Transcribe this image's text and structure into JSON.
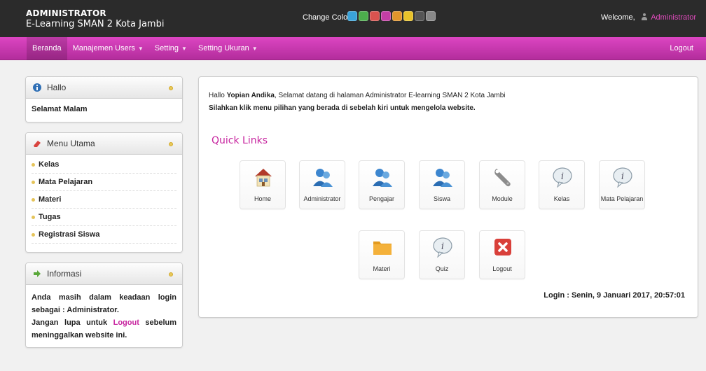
{
  "header": {
    "line1": "ADMINISTRATOR",
    "line2": "E-Learning SMAN 2 Kota Jambi",
    "change_color_label": "Change Color",
    "swatches": [
      "#3aa3d9",
      "#4cae4c",
      "#d9534f",
      "#c43ea6",
      "#e0952b",
      "#e8c22a",
      "#555555",
      "#888888"
    ],
    "welcome_label": "Welcome,",
    "username": "Administrator"
  },
  "nav": {
    "items": [
      {
        "label": "Beranda",
        "dropdown": false
      },
      {
        "label": "Manajemen Users",
        "dropdown": true
      },
      {
        "label": "Setting",
        "dropdown": true
      },
      {
        "label": "Setting Ukuran",
        "dropdown": true
      }
    ],
    "logout": "Logout",
    "caret": "▼"
  },
  "sidebar": {
    "hallo": {
      "title": "Hallo",
      "body": "Selamat Malam"
    },
    "menu": {
      "title": "Menu Utama",
      "items": [
        "Kelas",
        "Mata Pelajaran",
        "Materi",
        "Tugas",
        "Registrasi Siswa"
      ]
    },
    "info": {
      "title": "Informasi",
      "text1": "Anda masih dalam keadaan login sebagai : Administrator.",
      "text2": "Jangan lupa untuk",
      "logout_link": "Logout",
      "text3": "sebelum meninggalkan website ini."
    }
  },
  "main": {
    "greet_prefix": "Hallo",
    "greet_name": "Yopian Andika",
    "greet_suffix": ", Selamat datang di halaman Administrator E-learning SMAN 2 Kota Jambi",
    "instruction": "Silahkan klik menu pilihan yang berada di sebelah kiri untuk mengelola website.",
    "quick_links_title": "Quick Links",
    "tiles": [
      {
        "label": "Home",
        "icon": "home-icon"
      },
      {
        "label": "Administrator",
        "icon": "users-icon"
      },
      {
        "label": "Pengajar",
        "icon": "users-icon"
      },
      {
        "label": "Siswa",
        "icon": "users-icon"
      },
      {
        "label": "Module",
        "icon": "wrench-icon"
      },
      {
        "label": "Kelas",
        "icon": "info-bubble-icon"
      },
      {
        "label": "Mata Pelajaran",
        "icon": "info-bubble-icon"
      },
      {
        "label": "Materi",
        "icon": "folder-icon"
      },
      {
        "label": "Quiz",
        "icon": "info-bubble-icon"
      },
      {
        "label": "Logout",
        "icon": "close-red-icon"
      }
    ],
    "login_time": "Login : Senin, 9 Januari 2017, 20:57:01"
  }
}
